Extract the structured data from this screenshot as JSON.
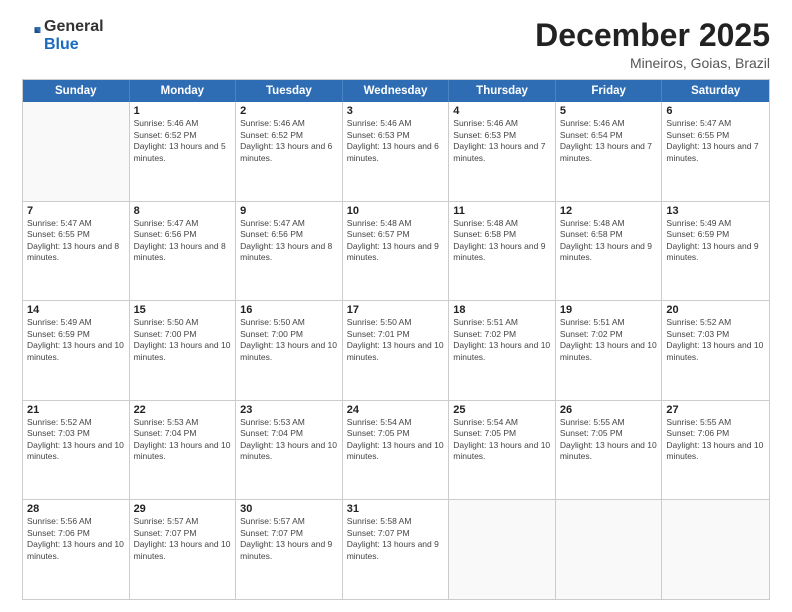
{
  "header": {
    "logo_general": "General",
    "logo_blue": "Blue",
    "month_title": "December 2025",
    "location": "Mineiros, Goias, Brazil"
  },
  "weekdays": [
    "Sunday",
    "Monday",
    "Tuesday",
    "Wednesday",
    "Thursday",
    "Friday",
    "Saturday"
  ],
  "weeks": [
    [
      {
        "day": "",
        "empty": true
      },
      {
        "day": "1",
        "sunrise": "5:46 AM",
        "sunset": "6:52 PM",
        "daylight": "13 hours and 5 minutes."
      },
      {
        "day": "2",
        "sunrise": "5:46 AM",
        "sunset": "6:52 PM",
        "daylight": "13 hours and 6 minutes."
      },
      {
        "day": "3",
        "sunrise": "5:46 AM",
        "sunset": "6:53 PM",
        "daylight": "13 hours and 6 minutes."
      },
      {
        "day": "4",
        "sunrise": "5:46 AM",
        "sunset": "6:53 PM",
        "daylight": "13 hours and 7 minutes."
      },
      {
        "day": "5",
        "sunrise": "5:46 AM",
        "sunset": "6:54 PM",
        "daylight": "13 hours and 7 minutes."
      },
      {
        "day": "6",
        "sunrise": "5:47 AM",
        "sunset": "6:55 PM",
        "daylight": "13 hours and 7 minutes."
      }
    ],
    [
      {
        "day": "7",
        "sunrise": "5:47 AM",
        "sunset": "6:55 PM",
        "daylight": "13 hours and 8 minutes."
      },
      {
        "day": "8",
        "sunrise": "5:47 AM",
        "sunset": "6:56 PM",
        "daylight": "13 hours and 8 minutes."
      },
      {
        "day": "9",
        "sunrise": "5:47 AM",
        "sunset": "6:56 PM",
        "daylight": "13 hours and 8 minutes."
      },
      {
        "day": "10",
        "sunrise": "5:48 AM",
        "sunset": "6:57 PM",
        "daylight": "13 hours and 9 minutes."
      },
      {
        "day": "11",
        "sunrise": "5:48 AM",
        "sunset": "6:58 PM",
        "daylight": "13 hours and 9 minutes."
      },
      {
        "day": "12",
        "sunrise": "5:48 AM",
        "sunset": "6:58 PM",
        "daylight": "13 hours and 9 minutes."
      },
      {
        "day": "13",
        "sunrise": "5:49 AM",
        "sunset": "6:59 PM",
        "daylight": "13 hours and 9 minutes."
      }
    ],
    [
      {
        "day": "14",
        "sunrise": "5:49 AM",
        "sunset": "6:59 PM",
        "daylight": "13 hours and 10 minutes."
      },
      {
        "day": "15",
        "sunrise": "5:50 AM",
        "sunset": "7:00 PM",
        "daylight": "13 hours and 10 minutes."
      },
      {
        "day": "16",
        "sunrise": "5:50 AM",
        "sunset": "7:00 PM",
        "daylight": "13 hours and 10 minutes."
      },
      {
        "day": "17",
        "sunrise": "5:50 AM",
        "sunset": "7:01 PM",
        "daylight": "13 hours and 10 minutes."
      },
      {
        "day": "18",
        "sunrise": "5:51 AM",
        "sunset": "7:02 PM",
        "daylight": "13 hours and 10 minutes."
      },
      {
        "day": "19",
        "sunrise": "5:51 AM",
        "sunset": "7:02 PM",
        "daylight": "13 hours and 10 minutes."
      },
      {
        "day": "20",
        "sunrise": "5:52 AM",
        "sunset": "7:03 PM",
        "daylight": "13 hours and 10 minutes."
      }
    ],
    [
      {
        "day": "21",
        "sunrise": "5:52 AM",
        "sunset": "7:03 PM",
        "daylight": "13 hours and 10 minutes."
      },
      {
        "day": "22",
        "sunrise": "5:53 AM",
        "sunset": "7:04 PM",
        "daylight": "13 hours and 10 minutes."
      },
      {
        "day": "23",
        "sunrise": "5:53 AM",
        "sunset": "7:04 PM",
        "daylight": "13 hours and 10 minutes."
      },
      {
        "day": "24",
        "sunrise": "5:54 AM",
        "sunset": "7:05 PM",
        "daylight": "13 hours and 10 minutes."
      },
      {
        "day": "25",
        "sunrise": "5:54 AM",
        "sunset": "7:05 PM",
        "daylight": "13 hours and 10 minutes."
      },
      {
        "day": "26",
        "sunrise": "5:55 AM",
        "sunset": "7:05 PM",
        "daylight": "13 hours and 10 minutes."
      },
      {
        "day": "27",
        "sunrise": "5:55 AM",
        "sunset": "7:06 PM",
        "daylight": "13 hours and 10 minutes."
      }
    ],
    [
      {
        "day": "28",
        "sunrise": "5:56 AM",
        "sunset": "7:06 PM",
        "daylight": "13 hours and 10 minutes."
      },
      {
        "day": "29",
        "sunrise": "5:57 AM",
        "sunset": "7:07 PM",
        "daylight": "13 hours and 10 minutes."
      },
      {
        "day": "30",
        "sunrise": "5:57 AM",
        "sunset": "7:07 PM",
        "daylight": "13 hours and 9 minutes."
      },
      {
        "day": "31",
        "sunrise": "5:58 AM",
        "sunset": "7:07 PM",
        "daylight": "13 hours and 9 minutes."
      },
      {
        "day": "",
        "empty": true
      },
      {
        "day": "",
        "empty": true
      },
      {
        "day": "",
        "empty": true
      }
    ]
  ]
}
